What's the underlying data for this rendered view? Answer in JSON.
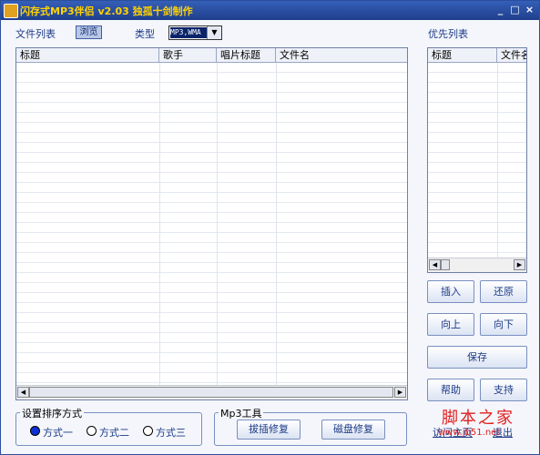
{
  "window": {
    "title": "闪存式MP3伴侣 v2.03 独孤十剑制作",
    "minimize_glyph": "_",
    "maximize_glyph": "□",
    "close_glyph": "×"
  },
  "toolbar": {
    "file_list_label": "文件列表",
    "browse_label": "浏览",
    "type_label": "类型",
    "type_value": "MP3,WMA",
    "priority_list_label": "优先列表"
  },
  "file_table": {
    "columns": [
      "标题",
      "歌手",
      "唱片标题",
      "文件名"
    ]
  },
  "priority_table": {
    "columns": [
      "标题",
      "文件名"
    ]
  },
  "side_buttons": {
    "insert": "插入",
    "restore": "还原",
    "move_up": "向上",
    "move_down": "向下",
    "save": "保存",
    "help": "帮助",
    "support": "支持"
  },
  "sort_group": {
    "title": "设置排序方式",
    "options": [
      "方式一",
      "方式二",
      "方式三"
    ],
    "selected": "方式一"
  },
  "mp3_tools": {
    "title": "Mp3工具",
    "plug_repair": "拔插修复",
    "disk_repair": "磁盘修复"
  },
  "bottom_links": {
    "visit_home": "访问主页",
    "exit": "退出"
  },
  "watermark": {
    "main": "脚本之家",
    "sub": "www.jb51.net"
  },
  "colors": {
    "title_bar": "#1f3f8c",
    "title_text": "#ffd200",
    "label_text": "#1b3a86",
    "watermark": "#e02020"
  }
}
